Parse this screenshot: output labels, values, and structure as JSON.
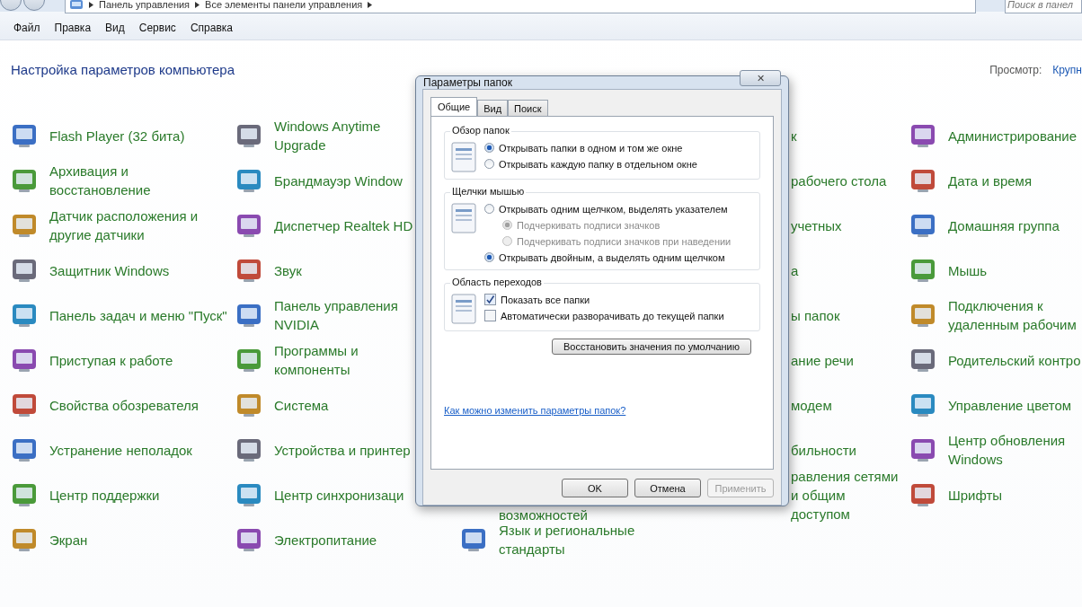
{
  "address_bar": {
    "breadcrumbs": [
      "Панель управления",
      "Все элементы панели управления"
    ],
    "search": {
      "placeholder": "Поиск в панел"
    }
  },
  "menu": [
    "Файл",
    "Правка",
    "Вид",
    "Сервис",
    "Справка"
  ],
  "header": {
    "title": "Настройка параметров компьютера",
    "view_label": "Просмотр:",
    "view_value": "Крупн"
  },
  "columns": [
    {
      "items": [
        {
          "label": "Flash Player (32 бита)"
        },
        {
          "label": "Архивация и восстановление"
        },
        {
          "label": "Датчик расположения и другие датчики"
        },
        {
          "label": "Защитник Windows"
        },
        {
          "label": "Панель задач и меню \"Пуск\""
        },
        {
          "label": "Приступая к работе"
        },
        {
          "label": "Свойства обозревателя"
        },
        {
          "label": "Устранение неполадок"
        },
        {
          "label": "Центр поддержки"
        },
        {
          "label": "Экран"
        }
      ]
    },
    {
      "items": [
        {
          "label": "Windows Anytime Upgrade"
        },
        {
          "label": "Брандмауэр Window"
        },
        {
          "label": "Диспетчер Realtek HD"
        },
        {
          "label": "Звук"
        },
        {
          "label": "Панель управления NVIDIA"
        },
        {
          "label": "Программы и компоненты"
        },
        {
          "label": "Система"
        },
        {
          "label": "Устройства и принтер"
        },
        {
          "label": "Центр синхронизаци"
        },
        {
          "label": "Электропитание"
        }
      ]
    },
    {
      "items": [
        {
          "label": "возможностей"
        },
        {
          "label": "Язык и региональные стандарты"
        }
      ]
    },
    {
      "items": [
        {
          "label": "к"
        },
        {
          "label": "рабочего стола"
        },
        {
          "label": "учетных"
        },
        {
          "label": "а"
        },
        {
          "label": "ы папок"
        },
        {
          "label": "ание речи"
        },
        {
          "label": "модем"
        },
        {
          "label": "бильности"
        },
        {
          "label": "равления сетями и общим доступом"
        }
      ]
    },
    {
      "items": [
        {
          "label": "Администрирование"
        },
        {
          "label": "Дата и время"
        },
        {
          "label": "Домашняя группа"
        },
        {
          "label": "Мышь"
        },
        {
          "label": "Подключения к удаленным рабочим"
        },
        {
          "label": "Родительский контро"
        },
        {
          "label": "Управление цветом"
        },
        {
          "label": "Центр обновления Windows"
        },
        {
          "label": "Шрифты"
        }
      ]
    }
  ],
  "dialog": {
    "title": "Параметры папок",
    "close": "✕",
    "tabs": [
      {
        "label": "Общие",
        "selected": true
      },
      {
        "label": "Вид",
        "selected": false
      },
      {
        "label": "Поиск",
        "selected": false
      }
    ],
    "groups": [
      {
        "title": "Обзор папок",
        "options": [
          {
            "kind": "radio",
            "label": "Открывать папки в одном и том же окне",
            "selected": true
          },
          {
            "kind": "radio",
            "label": "Открывать каждую папку в отдельном окне",
            "selected": false
          }
        ]
      },
      {
        "title": "Щелчки мышью",
        "options": [
          {
            "kind": "radio",
            "label": "Открывать одним щелчком, выделять указателем",
            "selected": false,
            "children": [
              {
                "kind": "radio",
                "label": "Подчеркивать подписи значков",
                "selected": true,
                "disabled": true
              },
              {
                "kind": "radio",
                "label": "Подчеркивать подписи значков при наведении",
                "selected": false,
                "disabled": true
              }
            ]
          },
          {
            "kind": "radio",
            "label": "Открывать двойным, а выделять одним щелчком",
            "selected": true
          }
        ]
      },
      {
        "title": "Область переходов",
        "options": [
          {
            "kind": "checkbox",
            "label": "Показать все папки",
            "checked": true
          },
          {
            "kind": "checkbox",
            "label": "Автоматически разворачивать до текущей папки",
            "checked": false
          }
        ]
      }
    ],
    "restore_button": "Восстановить значения по умолчанию",
    "help_link": "Как можно изменить параметры папок?",
    "buttons": [
      {
        "label": "OK",
        "disabled": false
      },
      {
        "label": "Отмена",
        "disabled": false
      },
      {
        "label": "Применить",
        "disabled": true
      }
    ]
  }
}
